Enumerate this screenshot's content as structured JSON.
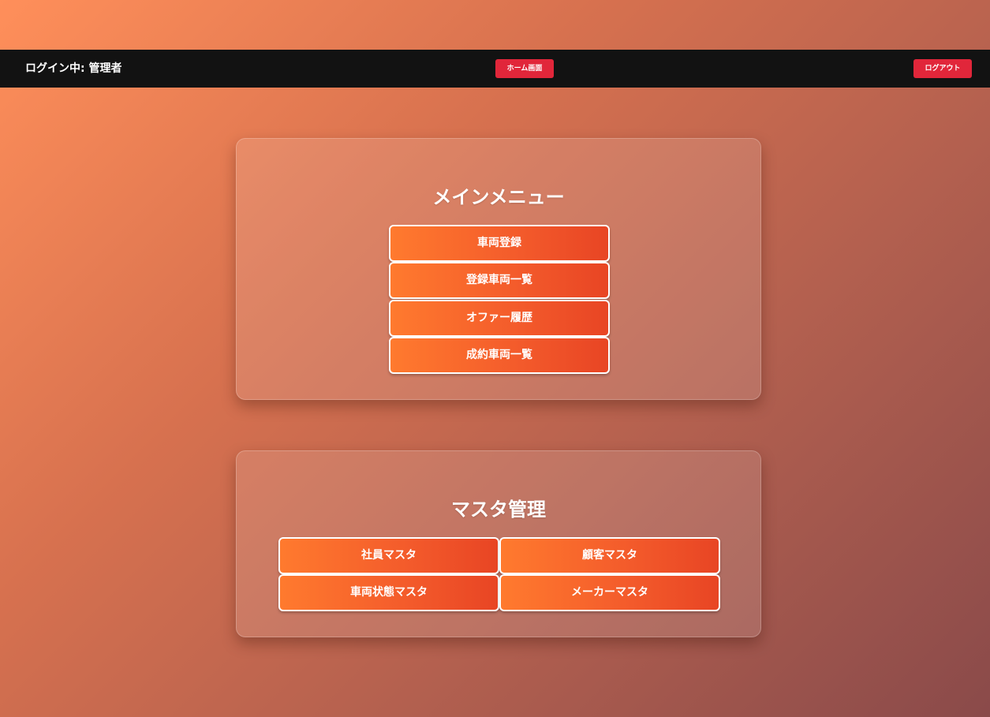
{
  "header": {
    "login_status": "ログイン中: 管理者",
    "home_label": "ホーム画面",
    "logout_label": "ログアウト"
  },
  "main_menu": {
    "title": "メインメニュー",
    "items": [
      {
        "label": "車両登録"
      },
      {
        "label": "登録車両一覧"
      },
      {
        "label": "オファー履歴"
      },
      {
        "label": "成約車両一覧"
      }
    ]
  },
  "master_menu": {
    "title": "マスタ管理",
    "items": [
      {
        "label": "社員マスタ"
      },
      {
        "label": "顧客マスタ"
      },
      {
        "label": "車両状態マスタ"
      },
      {
        "label": "メーカーマスタ"
      }
    ]
  },
  "colors": {
    "header_bg": "#121212",
    "nav_button": "#e1263a",
    "menu_button_start": "#ff7a2e",
    "menu_button_end": "#e84524"
  }
}
